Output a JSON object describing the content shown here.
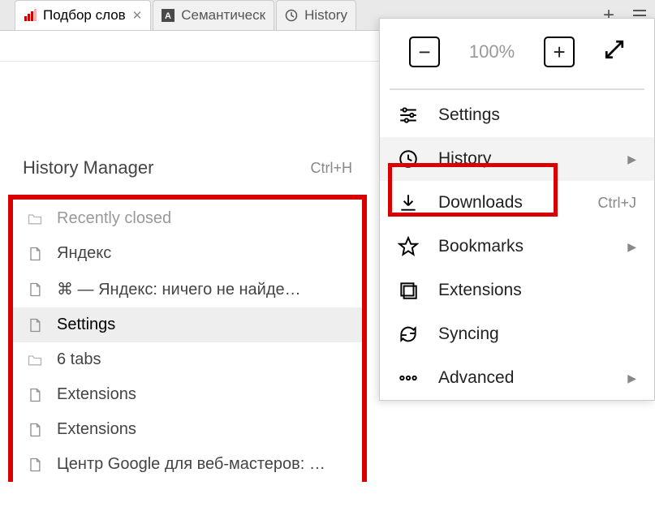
{
  "tabs": [
    {
      "label": "Подбор слов",
      "active": true
    },
    {
      "label": "Семантическ",
      "active": false
    },
    {
      "label": "History",
      "active": false
    }
  ],
  "zoom": {
    "minus": "−",
    "value": "100%",
    "plus": "+"
  },
  "menu": {
    "settings": {
      "label": "Settings"
    },
    "history": {
      "label": "History"
    },
    "downloads": {
      "label": "Downloads",
      "shortcut": "Ctrl+J"
    },
    "bookmarks": {
      "label": "Bookmarks"
    },
    "extensions": {
      "label": "Extensions"
    },
    "syncing": {
      "label": "Syncing"
    },
    "advanced": {
      "label": "Advanced"
    }
  },
  "history_manager": {
    "title": "History Manager",
    "shortcut": "Ctrl+H",
    "items": [
      {
        "kind": "folder",
        "label": "Recently closed",
        "muted": true
      },
      {
        "kind": "page",
        "label": "Яндекс"
      },
      {
        "kind": "page",
        "label": "⌘ — Яндекс: ничего не найде…"
      },
      {
        "kind": "page",
        "label": "Settings",
        "hover": true
      },
      {
        "kind": "folder",
        "label": "6 tabs"
      },
      {
        "kind": "page",
        "label": "Extensions"
      },
      {
        "kind": "page",
        "label": "Extensions"
      },
      {
        "kind": "page",
        "label": "Центр Google для веб-мастеров: …"
      }
    ]
  }
}
